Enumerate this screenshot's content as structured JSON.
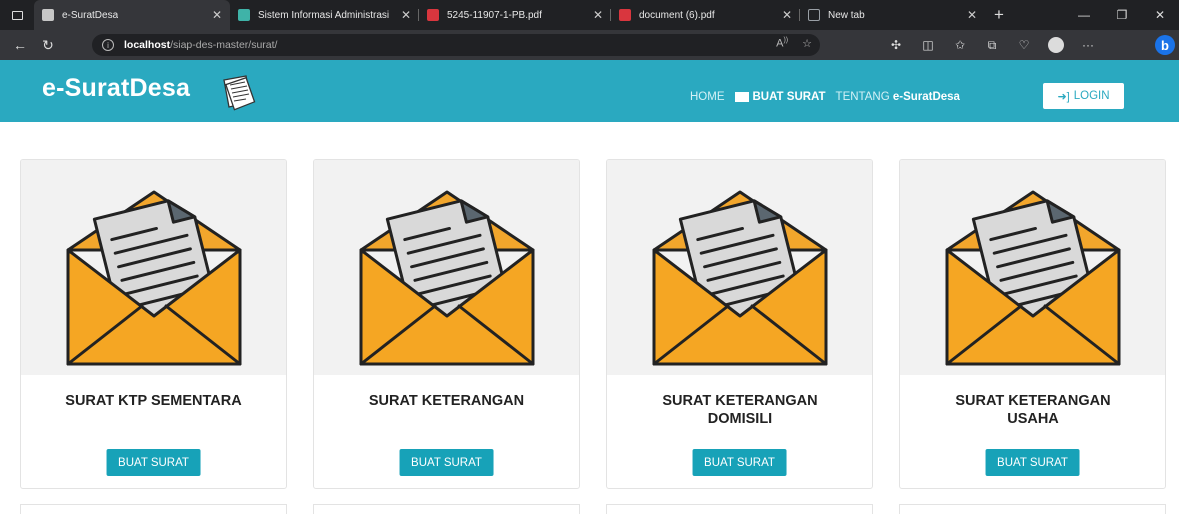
{
  "browser": {
    "tabs": [
      {
        "label": "e-SuratDesa",
        "favicon_color": "#c7c7c7",
        "active": true
      },
      {
        "label": "Sistem Informasi Administrasi",
        "favicon_color": "#3fb3a8",
        "active": false
      },
      {
        "label": "5245-11907-1-PB.pdf",
        "favicon_color": "#d9363e",
        "active": false
      },
      {
        "label": "document (6).pdf",
        "favicon_color": "#d9363e",
        "active": false
      },
      {
        "label": "New tab",
        "favicon_color": "#9aa0a6",
        "active": false
      }
    ],
    "url_host": "localhost",
    "url_path": "/siap-des-master/surat/"
  },
  "site": {
    "brand": "e-SuratDesa",
    "accent_color": "#2aa9c0",
    "menu": {
      "home": "HOME",
      "buat_surat": "BUAT SURAT",
      "tentang_prefix": "TENTANG",
      "tentang_brand": "e-SuratDesa"
    },
    "login": "LOGIN"
  },
  "cards": [
    {
      "title": "SURAT KTP SEMENTARA",
      "button": "BUAT SURAT"
    },
    {
      "title": "SURAT KETERANGAN",
      "button": "BUAT SURAT"
    },
    {
      "title": "SURAT KETERANGAN DOMISILI",
      "button": "BUAT SURAT"
    },
    {
      "title": "SURAT KETERANGAN USAHA",
      "button": "BUAT SURAT"
    }
  ]
}
